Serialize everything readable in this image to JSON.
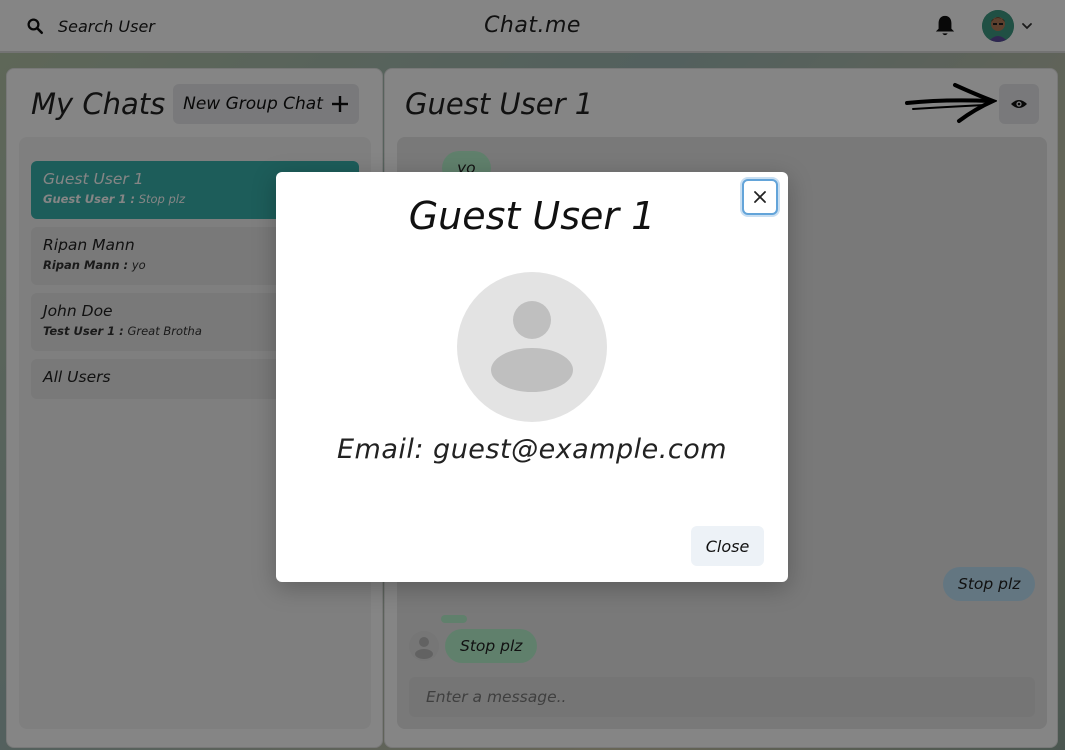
{
  "topbar": {
    "search_label": "Search User",
    "app_title": "Chat.me"
  },
  "sidebar": {
    "title": "My Chats",
    "new_group_label": "New Group Chat",
    "chats": [
      {
        "name": "Guest User 1",
        "last_sender": "Guest User 1 :",
        "last_message": "Stop plz",
        "active": true
      },
      {
        "name": "Ripan Mann",
        "last_sender": "Ripan Mann :",
        "last_message": "yo",
        "active": false
      },
      {
        "name": "John Doe",
        "last_sender": "Test User 1 :",
        "last_message": "Great Brotha",
        "active": false
      },
      {
        "name": "All Users",
        "last_sender": "",
        "last_message": "",
        "active": false
      }
    ]
  },
  "chat": {
    "title": "Guest User 1",
    "messages": [
      {
        "text": "yo",
        "from": "other"
      },
      {
        "text": "Stop plz",
        "from": "me"
      },
      {
        "text": "Stop plz",
        "from": "other"
      }
    ],
    "input_placeholder": "Enter a message.."
  },
  "modal": {
    "title": "Guest User 1",
    "email_text": "Email: guest@example.com",
    "close_label": "Close"
  },
  "colors": {
    "active_chat": "#38b2ac",
    "my_bubble": "#bee3f8",
    "their_bubble": "#b9f5d0"
  }
}
